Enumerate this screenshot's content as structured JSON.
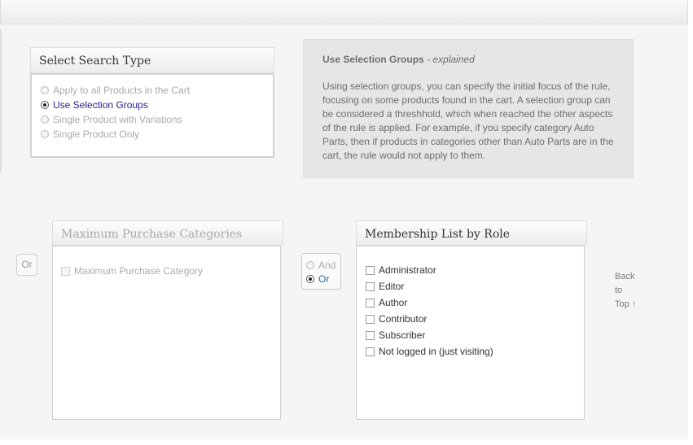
{
  "search_type": {
    "title": "Select Search Type",
    "options": [
      {
        "label": "Apply to all Products in the Cart",
        "checked": false,
        "enabled": false
      },
      {
        "label": "Use Selection Groups",
        "checked": true,
        "enabled": true
      },
      {
        "label": "Single Product with Variations",
        "checked": false,
        "enabled": false
      },
      {
        "label": "Single Product Only",
        "checked": false,
        "enabled": false
      }
    ]
  },
  "explain": {
    "title": "Use Selection Groups",
    "subtitle": " - explained",
    "text": "Using selection groups, you can specify the initial focus of the rule, focusing on some products found in the cart. A selection group can be considered a threshhold, which when reached the other aspects of the rule is applied. For example, if you specify category Auto Parts, then if products in categories other than Auto Parts are in the cart, the rule would not apply to them."
  },
  "or_button": "Or",
  "max_purchase": {
    "title": "Maximum Purchase Categories",
    "item": "Maximum Purchase Category"
  },
  "andor": {
    "and": "And",
    "or": "Or",
    "selected": "Or"
  },
  "membership": {
    "title": "Membership List by Role",
    "roles": [
      "Administrator",
      "Editor",
      "Author",
      "Contributor",
      "Subscriber",
      "Not logged in (just visiting)"
    ]
  },
  "back_to_top": [
    "Back",
    "to",
    "Top ↑"
  ],
  "colors": {
    "selected_text": "#1e1e8c",
    "or_text": "#2a6fa0",
    "panel_bg": "#e6e6e6"
  }
}
